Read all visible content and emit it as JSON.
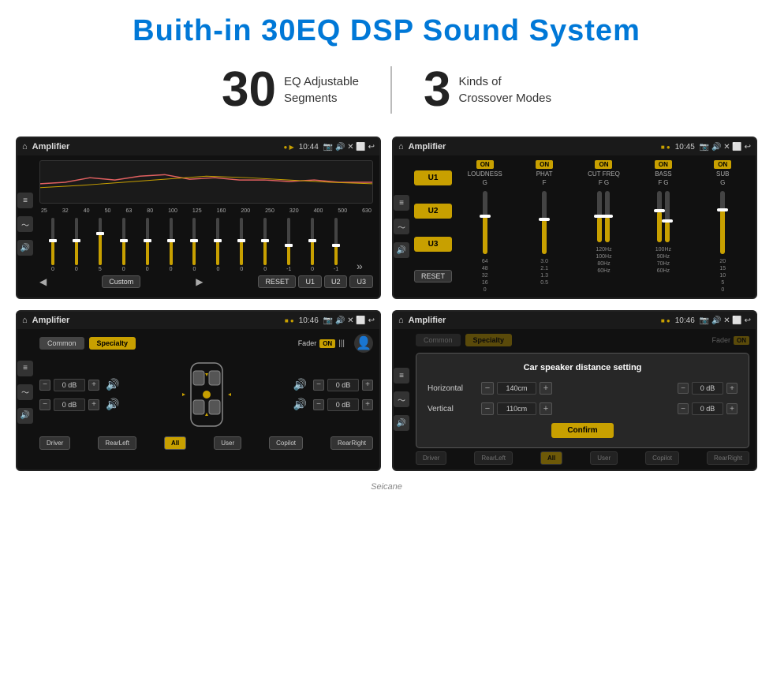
{
  "header": {
    "title": "Buith-in 30EQ DSP Sound System"
  },
  "stats": [
    {
      "number": "30",
      "label": "EQ Adjustable\nSegments"
    },
    {
      "number": "3",
      "label": "Kinds of\nCrossover Modes"
    }
  ],
  "screen1": {
    "title": "Amplifier",
    "time": "10:44",
    "eq_freqs": [
      "25",
      "32",
      "40",
      "50",
      "63",
      "80",
      "100",
      "125",
      "160",
      "200",
      "250",
      "320",
      "400",
      "500",
      "630"
    ],
    "eq_values": [
      "0",
      "0",
      "5",
      "0",
      "0",
      "0",
      "0",
      "0",
      "0",
      "0",
      "-1",
      "0",
      "-1"
    ],
    "eq_heights": [
      50,
      45,
      65,
      50,
      48,
      52,
      50,
      47,
      50,
      50,
      38,
      50,
      38
    ],
    "mode": "Custom",
    "buttons": [
      "RESET",
      "U1",
      "U2",
      "U3"
    ]
  },
  "screen2": {
    "title": "Amplifier",
    "time": "10:45",
    "presets": [
      "U1",
      "U2",
      "U3"
    ],
    "columns": [
      {
        "on": true,
        "label": "LOUDNESS",
        "freq_top": "G",
        "freq_bot": ""
      },
      {
        "on": true,
        "label": "PHAT",
        "freq_top": "F",
        "freq_bot": ""
      },
      {
        "on": true,
        "label": "CUT FREQ",
        "freq_top": "F",
        "freq_bot": "G"
      },
      {
        "on": true,
        "label": "BASS",
        "freq_top": "F",
        "freq_bot": "G"
      },
      {
        "on": true,
        "label": "SUB",
        "freq_top": "G",
        "freq_bot": ""
      }
    ],
    "reset_label": "RESET"
  },
  "screen3": {
    "title": "Amplifier",
    "time": "10:46",
    "tabs": [
      "Common",
      "Specialty"
    ],
    "active_tab": "Specialty",
    "fader_label": "Fader",
    "fader_on": "ON",
    "db_controls": [
      {
        "value": "0 dB",
        "position": "top-left"
      },
      {
        "value": "0 dB",
        "position": "bottom-left"
      },
      {
        "value": "0 dB",
        "position": "top-right"
      },
      {
        "value": "0 dB",
        "position": "bottom-right"
      }
    ],
    "bottom_btns": [
      "Driver",
      "RearLeft",
      "All",
      "User",
      "Copilot",
      "RearRight"
    ]
  },
  "screen4": {
    "title": "Amplifier",
    "time": "10:46",
    "tabs": [
      "Common",
      "Specialty"
    ],
    "active_tab": "Specialty",
    "dialog": {
      "title": "Car speaker distance setting",
      "horizontal_label": "Horizontal",
      "horizontal_value": "140cm",
      "vertical_label": "Vertical",
      "vertical_value": "110cm",
      "confirm_label": "Confirm"
    },
    "db_controls": [
      {
        "value": "0 dB"
      },
      {
        "value": "0 dB"
      }
    ],
    "bottom_btns": [
      "Driver",
      "RearLeft",
      "User",
      "Copilot",
      "RearRight"
    ]
  },
  "watermark": "Seicane"
}
